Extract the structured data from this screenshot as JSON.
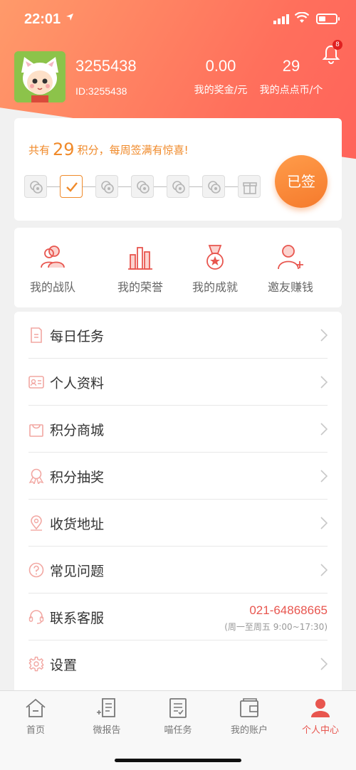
{
  "status": {
    "time": "22:01"
  },
  "header": {
    "username": "3255438",
    "user_id": "ID:3255438",
    "notification_count": "8",
    "stats": [
      {
        "value": "0.00",
        "label": "我的奖金/元"
      },
      {
        "value": "29",
        "label": "我的点点币/个"
      }
    ]
  },
  "checkin": {
    "prefix": "共有",
    "points": "29",
    "suffix": "积分，每周签满有惊喜!",
    "signed_label": "已签",
    "days_total": 7,
    "days_signed": 1
  },
  "quick_links": [
    {
      "label": "我的战队",
      "icon": "team-icon"
    },
    {
      "label": "我的荣誉",
      "icon": "honor-icon"
    },
    {
      "label": "我的成就",
      "icon": "medal-icon"
    },
    {
      "label": "邀友赚钱",
      "icon": "invite-icon"
    }
  ],
  "menu": [
    {
      "label": "每日任务",
      "icon": "task-icon"
    },
    {
      "label": "个人资料",
      "icon": "profile-icon"
    },
    {
      "label": "积分商城",
      "icon": "shop-icon"
    },
    {
      "label": "积分抽奖",
      "icon": "lottery-icon"
    },
    {
      "label": "收货地址",
      "icon": "location-icon"
    },
    {
      "label": "常见问题",
      "icon": "question-icon"
    },
    {
      "label": "联系客服",
      "icon": "headset-icon",
      "phone": "021-64868665",
      "hours": "(周一至周五 9:00~17:30)"
    },
    {
      "label": "设置",
      "icon": "gear-icon"
    }
  ],
  "tabs": [
    {
      "label": "首页",
      "icon": "home-icon"
    },
    {
      "label": "微报告",
      "icon": "report-icon"
    },
    {
      "label": "喵任务",
      "icon": "task-list-icon"
    },
    {
      "label": "我的账户",
      "icon": "wallet-icon"
    },
    {
      "label": "个人中心",
      "icon": "person-icon",
      "active": true
    }
  ],
  "colors": {
    "accent": "#e8564f",
    "orange": "#f08a2a",
    "hero_start": "#ff9a6a",
    "hero_end": "#ff5f5a"
  }
}
